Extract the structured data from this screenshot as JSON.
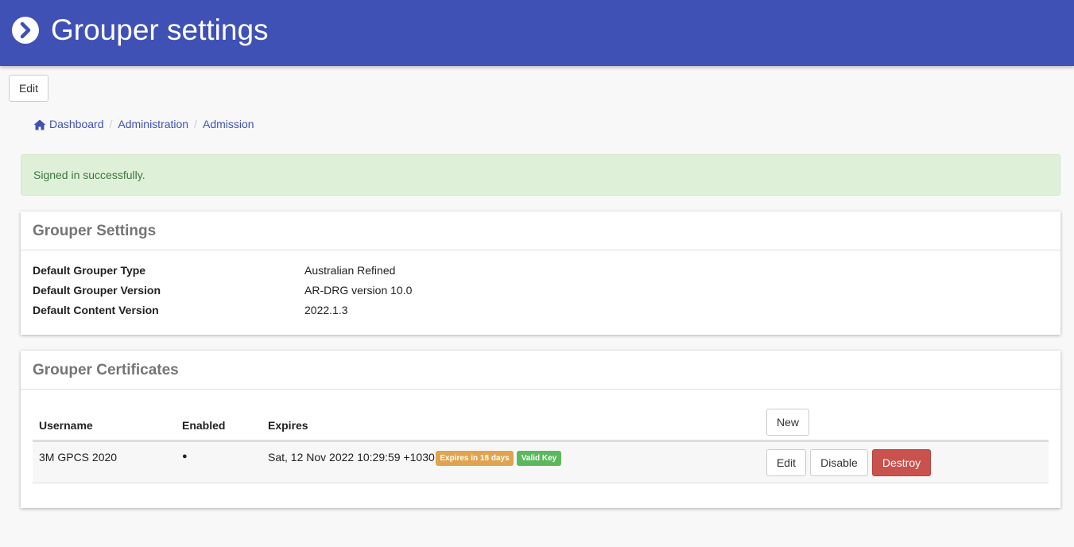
{
  "header": {
    "title": "Grouper settings",
    "logo_icon": "chevron-right-circle-icon"
  },
  "toolbar": {
    "edit_label": "Edit"
  },
  "breadcrumb": {
    "items": [
      "Dashboard",
      "Administration",
      "Admission"
    ],
    "home_icon": "home-icon"
  },
  "alert": {
    "message": "Signed in successfully."
  },
  "settings_panel": {
    "title": "Grouper Settings",
    "rows": [
      {
        "label": "Default Grouper Type",
        "value": "Australian Refined"
      },
      {
        "label": "Default Grouper Version",
        "value": "AR-DRG version 10.0"
      },
      {
        "label": "Default Content Version",
        "value": "2022.1.3"
      }
    ]
  },
  "certificates_panel": {
    "title": "Grouper Certificates",
    "columns": [
      "Username",
      "Enabled",
      "Expires"
    ],
    "new_label": "New",
    "rows": [
      {
        "username": "3M GPCS 2020",
        "enabled": "●",
        "expires": "Sat, 12 Nov 2022 10:29:59 +1030",
        "badges": [
          "Expires in 18 days",
          "Valid Key"
        ],
        "actions": [
          "Edit",
          "Disable",
          "Destroy"
        ]
      }
    ]
  },
  "colors": {
    "header": "#3f51b5",
    "alert_bg": "#dff0d8",
    "alert_text": "#3c763d",
    "badge_warning": "#e0a34e",
    "badge_success": "#5cb85c",
    "danger": "#c9524e"
  }
}
